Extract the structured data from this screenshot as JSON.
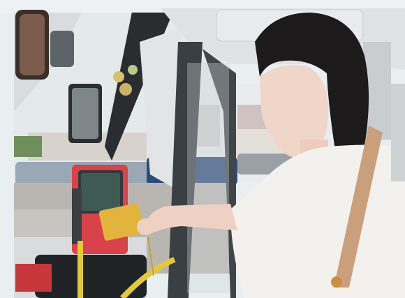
{
  "scene": {
    "description_tags": [
      "bus-interior",
      "card-reader",
      "passenger-tapping-card",
      "parking-lot-outside"
    ],
    "colors": {
      "frame": "#e9eef1",
      "sky": "#e7ecef",
      "bus_ceiling": "#dfe3e5",
      "reader_body": "#d9424a",
      "reader_screen": "#2f3a3e",
      "card": "#e3b43c",
      "shirt": "#f3f1ee",
      "hair": "#1c1a1a",
      "strap": "#caa07c",
      "rail": "#e2c937",
      "door_frame": "#3a3f44"
    }
  }
}
